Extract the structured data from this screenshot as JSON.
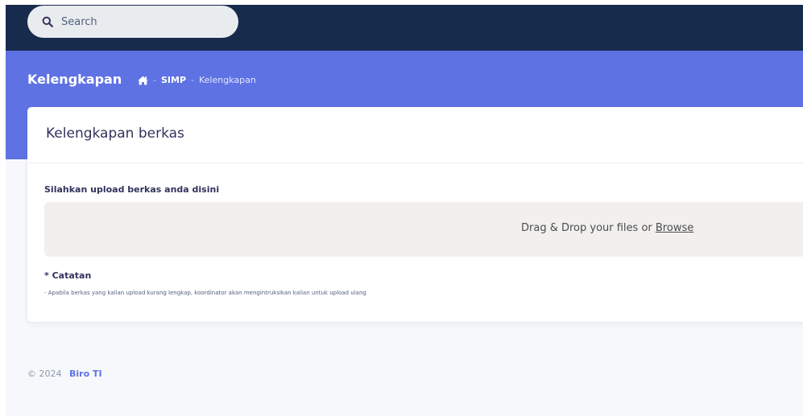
{
  "search": {
    "placeholder": "Search",
    "icon": "search-icon"
  },
  "header": {
    "title": "Kelengkapan",
    "breadcrumb": {
      "home_icon": "home-icon",
      "separator": "-",
      "items": [
        "SIMP",
        "Kelengkapan"
      ]
    }
  },
  "card": {
    "title": "Kelengkapan berkas",
    "upload_label": "Silahkan upload berkas anda disini",
    "dropzone": {
      "text": "Drag & Drop your files or",
      "browse": "Browse"
    },
    "note_title": "* Catatan",
    "note_text": "- Apabila berkas yang kalian upload kurang lengkap, koordinator akan mengintruksikan kalian untuk upload ulang"
  },
  "footer": {
    "copyright": "© 2024",
    "brand": "Biro TI"
  },
  "colors": {
    "topbar": "#172b4d",
    "header": "#5e72e4",
    "accent": "#5e72e4",
    "background": "#f7f8fc"
  }
}
